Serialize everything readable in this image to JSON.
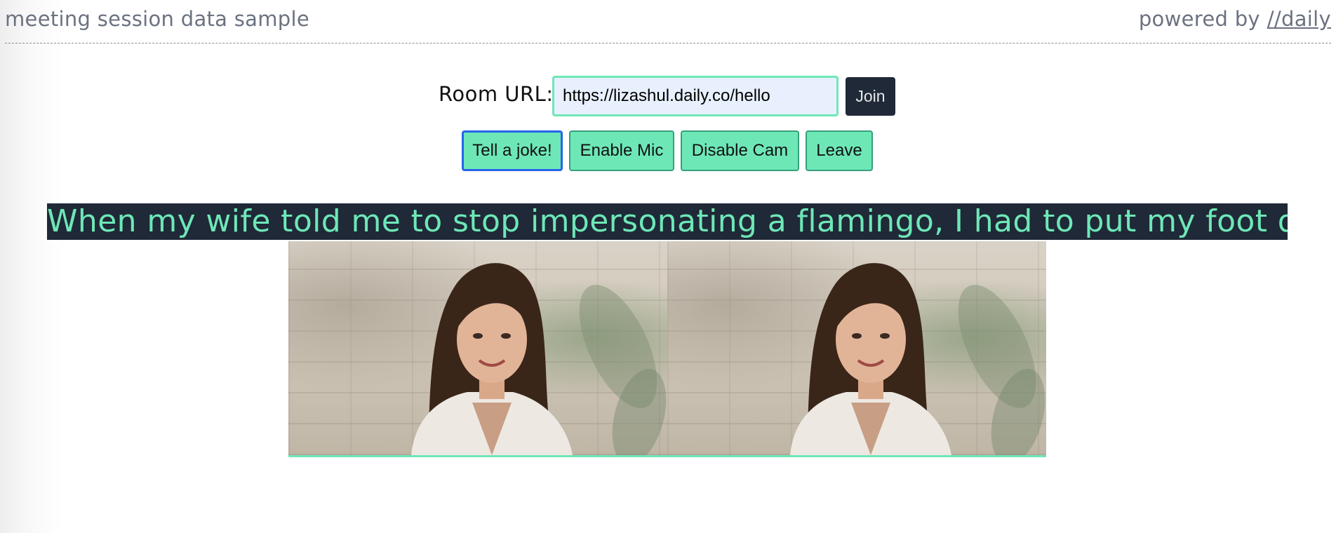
{
  "header": {
    "title": "meeting session data sample",
    "powered_prefix": "powered by",
    "powered_link": "//daily"
  },
  "room": {
    "label": "Room URL:",
    "url_value": "https://lizashul.daily.co/hello",
    "join_label": "Join"
  },
  "actions": {
    "joke_label": "Tell a joke!",
    "mic_label": "Enable Mic",
    "cam_label": "Disable Cam",
    "leave_label": "Leave"
  },
  "joke": {
    "text": "When my wife told me to stop impersonating a flamingo, I had to put my foot down."
  },
  "colors": {
    "accent": "#6ee7b7",
    "dark": "#1f2937",
    "muted_text": "#6b7280",
    "input_bg": "#e8f0fe",
    "focus_ring": "#2563eb"
  },
  "videos": [
    {
      "name": "participant-video-1"
    },
    {
      "name": "participant-video-2"
    }
  ]
}
